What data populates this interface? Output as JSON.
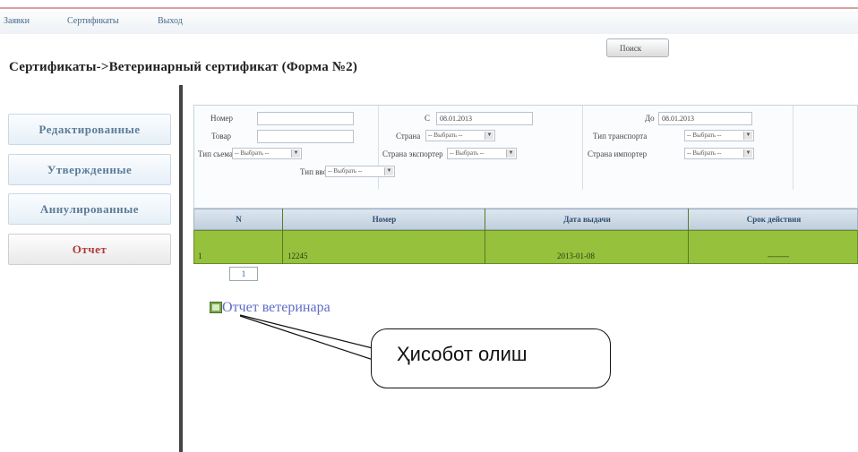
{
  "topnav": {
    "item1": "Заявки",
    "item2": "Сертификаты",
    "item3": "Выход"
  },
  "page_title": "Сертификаты->Ветеринарный сертификат (Форма №2)",
  "sidebar": {
    "items": [
      {
        "label": "Редактированные"
      },
      {
        "label": "Утвержденные"
      },
      {
        "label": "Аннулированные"
      },
      {
        "label": "Отчет"
      }
    ]
  },
  "filters": {
    "nomer_label": "Номер",
    "nomer_value": "",
    "tovar_label": "Товар",
    "tovar_value": "",
    "tip_svoma_label": "Тип сьема",
    "tip_svoma_value": "-- Выбрать --",
    "tip_vvoz_label": "Тип ввоз",
    "tip_vvoz_value": "-- Выбрать --",
    "c_label": "С",
    "c_value": "08.01.2013",
    "strana_label": "Страна",
    "strana_value": "-- Выбрать --",
    "strana_exporter_label": "Страна экспортер",
    "strana_exporter_value": "-- Выбрать --",
    "do_label": "До",
    "do_value": "08.01.2013",
    "tip_transporta_label": "Тип транспорта",
    "tip_transporta_value": "-- Выбрать --",
    "strana_importer_label": "Страна импортер",
    "strana_importer_value": "-- Выбрать --",
    "search_button": "Поиск"
  },
  "table": {
    "headers": {
      "n": "N",
      "nomer": "Номер",
      "data": "Дата выдачи",
      "srok": "Срок действия"
    },
    "rows": [
      {
        "n": "1",
        "nomer": "12245",
        "data": "2013-01-08",
        "srok": "--------"
      }
    ]
  },
  "pager": {
    "page": "1"
  },
  "report_link": "Отчет ветеринара",
  "callout_text": "Ҳисобот олиш",
  "colors": {
    "row_green": "#95c13d",
    "active_side_text": "#b03a3a",
    "link_blue": "#5d6cc8"
  },
  "icons": [
    "report-icon",
    "dropdown-arrow-icon"
  ]
}
